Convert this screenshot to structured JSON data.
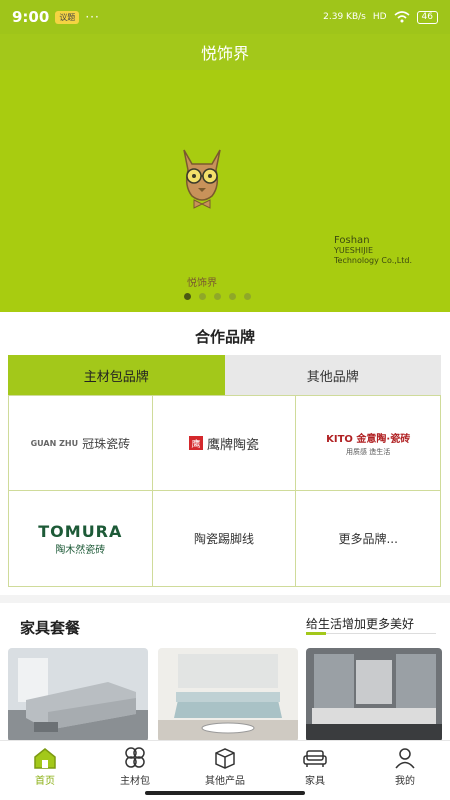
{
  "status_bar": {
    "time": "9:00",
    "pill": "议题",
    "net_speed": "2.39 KB/s",
    "signal": "HD",
    "battery": "46"
  },
  "header": {
    "title": "悦饰界"
  },
  "banner": {
    "logo_text": "悦饰界",
    "company_line1": "Foshan",
    "company_line2": "YUESHIJIE",
    "company_line3": "Technology Co.,Ltd.",
    "active_slide": 1,
    "slide_count": 5
  },
  "brands": {
    "title": "合作品牌",
    "tabs": [
      "主材包品牌",
      "其他品牌"
    ],
    "active_tab": 0,
    "items": [
      {
        "mark": "GUAN ZHU",
        "name": "冠珠瓷砖"
      },
      {
        "mark": "鹰",
        "name": "鹰牌陶瓷"
      },
      {
        "name": "KITO 金意陶·瓷砖",
        "sub": "用质感 造生活"
      },
      {
        "name": "TOMURA",
        "sub": "陶木然瓷砖"
      },
      {
        "name": "陶瓷踢脚线"
      },
      {
        "name": "更多品牌..."
      }
    ]
  },
  "furniture": {
    "title": "家具套餐",
    "slogan": "给生活增加更多美好"
  },
  "nav": {
    "items": [
      {
        "label": "首页",
        "icon": "home-icon"
      },
      {
        "label": "主材包",
        "icon": "clover-icon"
      },
      {
        "label": "其他产品",
        "icon": "box-icon"
      },
      {
        "label": "家具",
        "icon": "sofa-icon"
      },
      {
        "label": "我的",
        "icon": "user-icon"
      }
    ],
    "active": 0
  },
  "colors": {
    "brand_green": "#a3c81a",
    "banner_green": "#a8cc10",
    "active_nav": "#8bb016"
  }
}
